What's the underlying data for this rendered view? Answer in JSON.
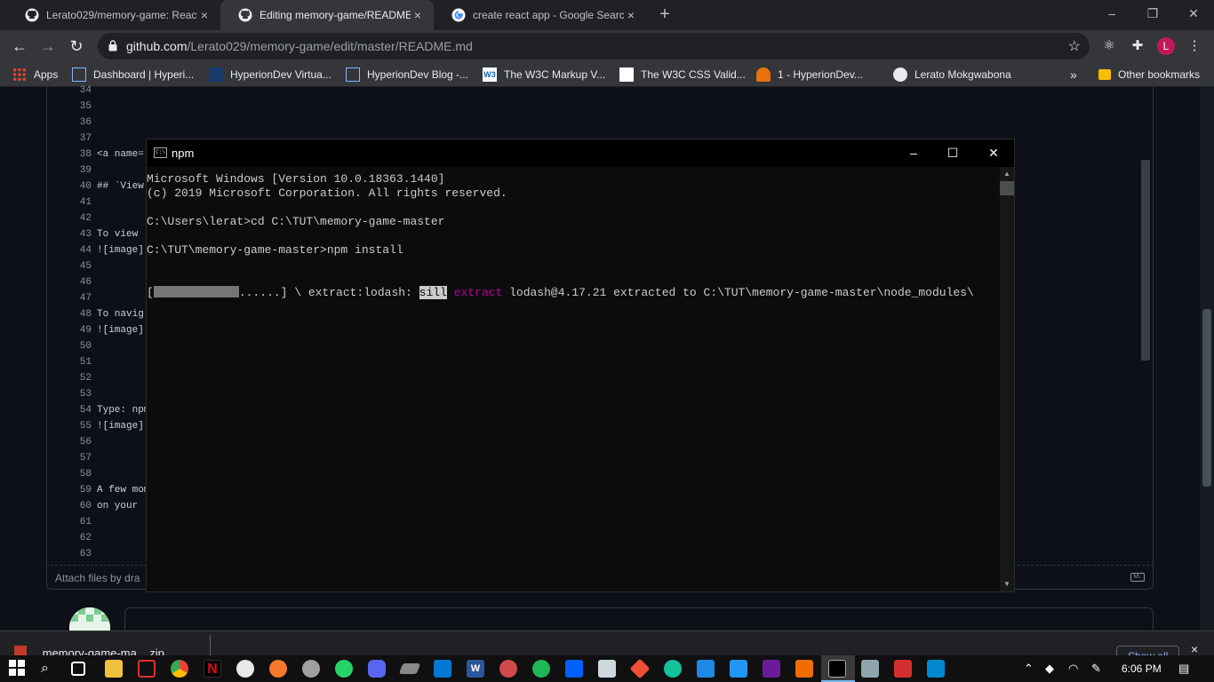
{
  "browser": {
    "tabs": [
      {
        "title": "Lerato029/memory-game: React",
        "active": false
      },
      {
        "title": "Editing memory-game/README.md",
        "active": true
      },
      {
        "title": "create react app - Google Search",
        "active": false
      }
    ],
    "tab_close_glyph": "×",
    "new_tab_glyph": "+",
    "address": {
      "host": "github.com",
      "path": "/Lerato029/memory-game/edit/master/README.md"
    },
    "profile_initial": "L",
    "bookmarks": [
      "Apps",
      "Dashboard | Hyperi...",
      "HyperionDev Virtua...",
      "HyperionDev Blog -...",
      "The W3C Markup V...",
      "The W3C CSS Valid...",
      "1 - HyperionDev...",
      "Lerato Mokgwabona"
    ],
    "bookmarks_overflow": "»",
    "other_bookmarks": "Other bookmarks"
  },
  "editor": {
    "lines": [
      {
        "num": "34",
        "text": ""
      },
      {
        "num": "35",
        "text": ""
      },
      {
        "num": "36",
        "text": ""
      },
      {
        "num": "37",
        "text": ""
      },
      {
        "num": "38",
        "text": "<a name="
      },
      {
        "num": "39",
        "text": ""
      },
      {
        "num": "40",
        "text": "## `View"
      },
      {
        "num": "41",
        "text": ""
      },
      {
        "num": "42",
        "text": ""
      },
      {
        "num": "43",
        "text": "To view"
      },
      {
        "num": "44",
        "text": "![image]"
      },
      {
        "num": "45",
        "text": ""
      },
      {
        "num": "46",
        "text": ""
      },
      {
        "num": "47",
        "text": ""
      },
      {
        "num": "48",
        "text": "To navig"
      },
      {
        "num": "49",
        "text": "![image]"
      },
      {
        "num": "50",
        "text": ""
      },
      {
        "num": "51",
        "text": ""
      },
      {
        "num": "52",
        "text": ""
      },
      {
        "num": "53",
        "text": ""
      },
      {
        "num": "54",
        "text": "Type: npm"
      },
      {
        "num": "55",
        "text": "![image]"
      },
      {
        "num": "56",
        "text": ""
      },
      {
        "num": "57",
        "text": ""
      },
      {
        "num": "58",
        "text": ""
      },
      {
        "num": "59",
        "text": "A few mom"
      },
      {
        "num": "60",
        "text": "on your"
      },
      {
        "num": "61",
        "text": ""
      },
      {
        "num": "62",
        "text": ""
      },
      {
        "num": "63",
        "text": ""
      }
    ],
    "attach_label": "Attach files by dra",
    "markdown_badge": "M↓"
  },
  "cmd": {
    "title": "npm",
    "icon_text": "C:\\",
    "controls": {
      "minimize": "–",
      "maximize": "☐",
      "close": "✕"
    },
    "lines": [
      "Microsoft Windows [Version 10.0.18363.1440]",
      "(c) 2019 Microsoft Corporation. All rights reserved.",
      "",
      "C:\\Users\\lerat>cd C:\\TUT\\memory-game-master",
      "",
      "C:\\TUT\\memory-game-master>npm install"
    ],
    "progress_progress": 0.62,
    "progress": {
      "open": "[",
      "rest": "......] \\ extract:lodash: ",
      "level": "sill",
      "verb": "extract",
      "message": " lodash@4.17.21 extracted to C:\\TUT\\memory-game-master\\node_modules\\"
    }
  },
  "downloads": {
    "file": "memory-game-ma....zip",
    "show_all": "Show all",
    "close_glyph": "×"
  },
  "taskbar": {
    "time": "6:06 PM"
  }
}
